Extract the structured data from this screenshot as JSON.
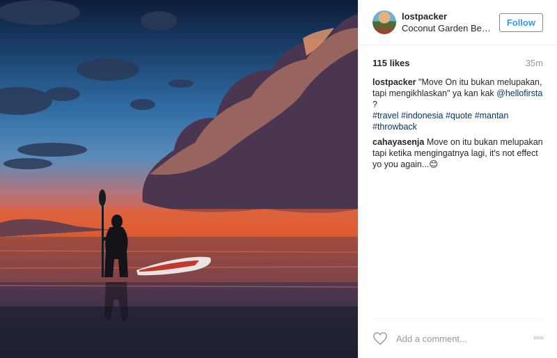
{
  "post": {
    "image_alt": "silhouette with paddle and paddleboard at sunset",
    "username": "lostpacker",
    "location": "Coconut Garden Beach",
    "follow_label": "Follow",
    "likes": "115 likes",
    "time": "35m",
    "caption": {
      "user": "lostpacker",
      "text": "\"Move On itu bukan melupakan, tapi mengikhlaskan\" ya kan kak ",
      "mention": "@hellofirsta",
      "after": " ?",
      "tags": [
        "#travel",
        "#indonesia",
        "#quote",
        "#mantan",
        "#throwback"
      ]
    },
    "comments": [
      {
        "user": "cahayasenja",
        "text": "Move on itu bukan melupakan tapi ketika mengingatnya lagi, it's not effect yo you again...😊"
      }
    ],
    "add_comment_placeholder": "Add a comment...",
    "more_label": "◦◦◦"
  },
  "colors": {
    "accent": "#3897f0",
    "link": "#003569",
    "muted": "#999999"
  },
  "icons": {
    "like": "heart-outline-icon",
    "more": "more-options-icon"
  }
}
